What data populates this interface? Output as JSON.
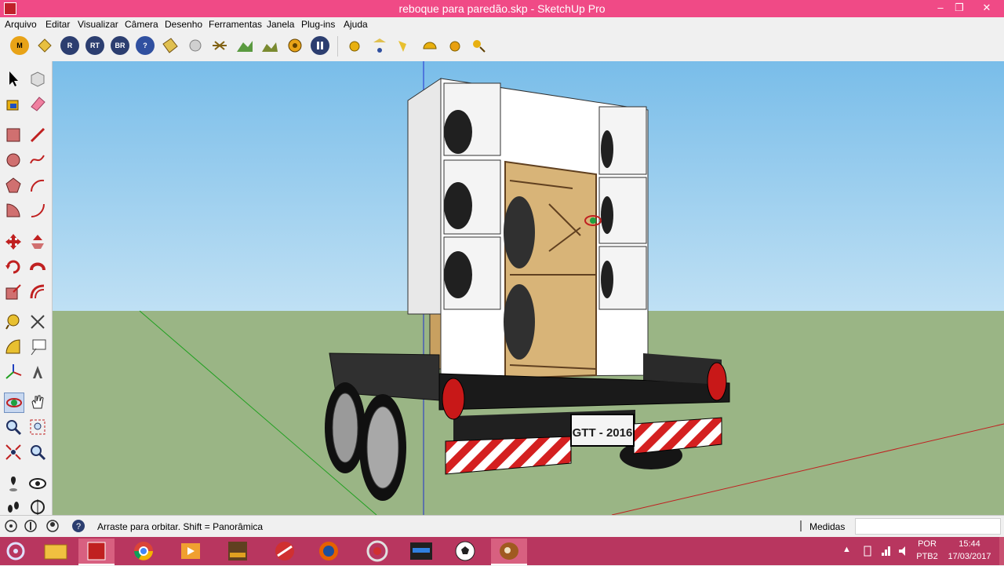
{
  "window": {
    "title": "reboque para paredão.skp - SketchUp Pro",
    "controls": [
      "–",
      "❐",
      "✕"
    ]
  },
  "menu": [
    "Arquivo",
    "Editar",
    "Visualizar",
    "Câmera",
    "Desenho",
    "Ferramentas",
    "Janela",
    "Plug-ins",
    "Ajuda"
  ],
  "toolbar": {
    "plugins": [
      {
        "label": "M",
        "icon": "plugin-m-icon"
      },
      {
        "label": "",
        "icon": "tag-icon"
      },
      {
        "label": "R",
        "icon": "plugin-r-icon"
      },
      {
        "label": "RT",
        "icon": "plugin-rt-icon"
      },
      {
        "label": "BR",
        "icon": "plugin-br-icon"
      },
      {
        "label": "?",
        "icon": "help-icon"
      },
      {
        "label": "",
        "icon": "materials-icon"
      },
      {
        "label": "",
        "icon": "sphere-icon"
      },
      {
        "label": "",
        "icon": "light-icon"
      },
      {
        "label": "",
        "icon": "landscape-icon"
      },
      {
        "label": "",
        "icon": "landscape2-icon"
      },
      {
        "label": "",
        "icon": "target-icon"
      },
      {
        "label": "",
        "icon": "pause-icon"
      }
    ],
    "render": [
      "sun-icon",
      "lamp-icon",
      "spotlight-icon",
      "dome-icon",
      "sphere2-icon",
      "cursor-light-icon"
    ]
  },
  "status": {
    "hint": "Arraste para orbitar. Shift = Panorâmica",
    "measure_label": "Medidas",
    "measure_value": ""
  },
  "model": {
    "plate": "GTT - 2016"
  },
  "taskbar": {
    "apps": [
      "hazard-icon",
      "file-explorer-icon",
      "sketchup-icon",
      "chrome-icon",
      "video-icon",
      "flatout-icon",
      "game-icon",
      "firefox-icon",
      "recorder-icon",
      "nfs-icon",
      "soccer-icon",
      "baseball-glove-icon"
    ],
    "lang": "POR",
    "layout": "PTB2",
    "time": "15:44",
    "date": "17/03/2017"
  }
}
